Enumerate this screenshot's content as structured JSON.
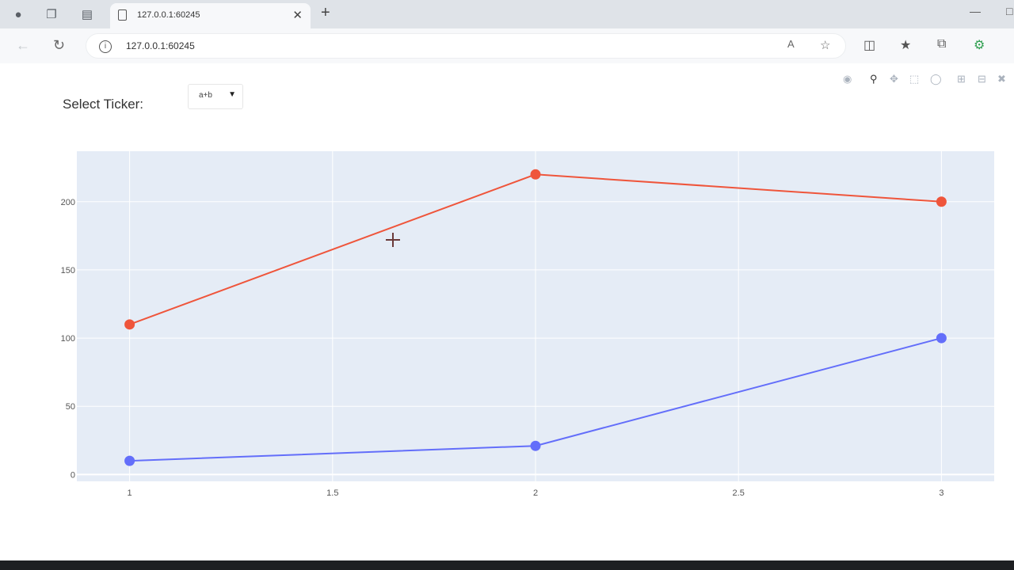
{
  "browser": {
    "tab_title": "127.0.0.1:60245",
    "url": "127.0.0.1:60245"
  },
  "page": {
    "ticker_label": "Select Ticker:",
    "ticker_value": "a+b"
  },
  "chart_data": {
    "type": "line",
    "x": [
      1,
      2,
      3
    ],
    "series": [
      {
        "values": [
          110,
          220,
          200
        ],
        "color": "#ef553b"
      },
      {
        "values": [
          10,
          21,
          100
        ],
        "color": "#636efa"
      }
    ],
    "xlim": [
      0.87,
      3.13
    ],
    "ylim": [
      -5,
      237
    ],
    "x_ticks": [
      1,
      1.5,
      2,
      2.5,
      3
    ],
    "x_tick_labels": [
      "1",
      "1.5",
      "2",
      "2.5",
      "3"
    ],
    "y_ticks": [
      0,
      50,
      100,
      150,
      200
    ],
    "y_tick_labels": [
      "0",
      "50",
      "100",
      "150",
      "200"
    ],
    "grid": true,
    "plot_bg": "#e5ecf6"
  }
}
